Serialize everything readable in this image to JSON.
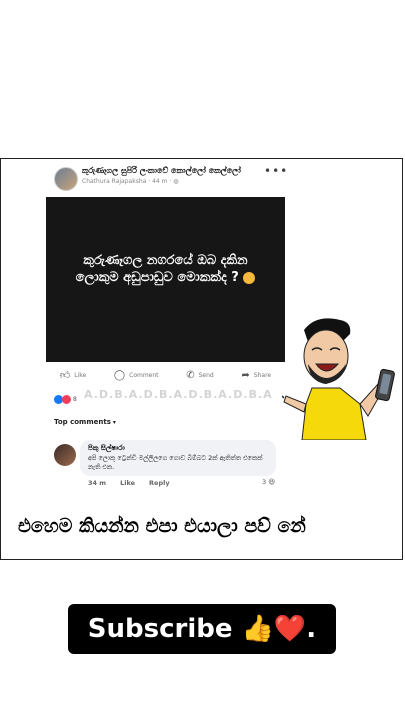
{
  "post": {
    "group_name": "කුරුණෑගල සුපිරි ලංකාවේ කොල්ලෝ කෙල්ලෝ",
    "author": "Chathura Rajapaksha",
    "time": "44 m",
    "more": "•••",
    "image_text": "කුරුණෑගල නගරයේ ඔබ දකින ලොකුම අඩුපාඩුව මොකක්ද ?"
  },
  "actions": {
    "like": "Like",
    "comment": "Comment",
    "send": "Send",
    "share": "Share"
  },
  "reactions": {
    "count": "8"
  },
  "watermark": "A.D.B.A.D.B.A.D.B.A.D.B.A",
  "top_comments": {
    "label": "Top comments"
  },
  "comment": {
    "author": "පිකු සිල්ෂාරා",
    "text": "අපි ලොකු ට්‍රෙන්ඩි මල්ලිලගෙ ගොඩ බිම්බට 2ක් ඇතිත්ත එකෙක් නැති එක.",
    "time": "34 m",
    "like": "Like",
    "reply": "Reply",
    "reaction_count": "3"
  },
  "caption": "එහෙම කියන්න එපා එයාලා පව් නේ",
  "subscribe": "Subscribe 👍❤️.",
  "colors": {
    "accent": "#1877f2",
    "love": "#f33e58",
    "shirt": "#f5d90a"
  },
  "icons": [
    "like-icon",
    "comment-icon",
    "send-icon",
    "share-icon",
    "globe-icon"
  ]
}
